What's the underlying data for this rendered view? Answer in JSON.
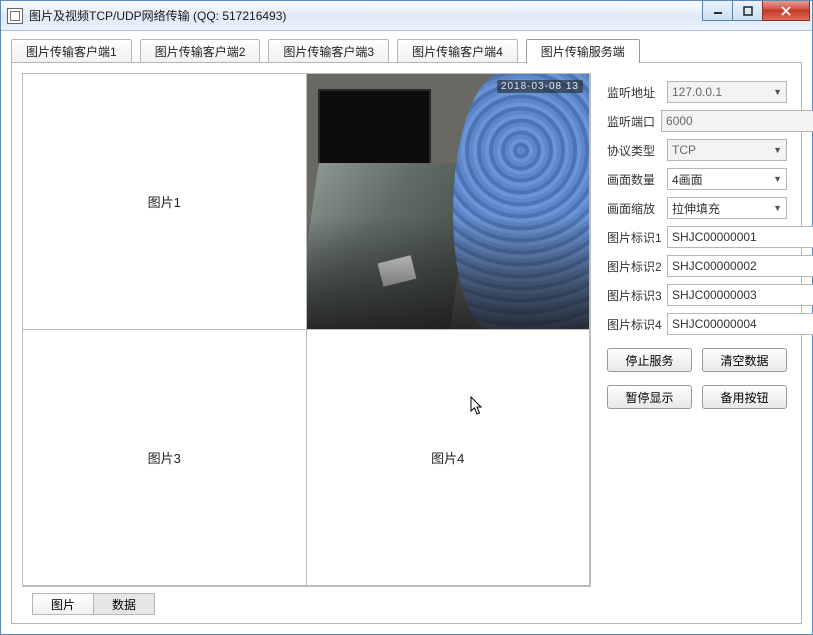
{
  "window_title": "图片及视频TCP/UDP网络传输 (QQ: 517216493)",
  "tabs": {
    "client1": "图片传输客户端1",
    "client2": "图片传输客户端2",
    "client3": "图片传输客户端3",
    "client4": "图片传输客户端4",
    "server": "图片传输服务端"
  },
  "panes": {
    "p1": "图片1",
    "p3": "图片3",
    "p4": "图片4",
    "video_overlay": "2018-03-08 13"
  },
  "subtabs": {
    "image": "图片",
    "data": "数据"
  },
  "form": {
    "listen_addr_label": "监听地址",
    "listen_addr_value": "127.0.0.1",
    "listen_port_label": "监听端口",
    "listen_port_value": "6000",
    "protocol_label": "协议类型",
    "protocol_value": "TCP",
    "count_label": "画面数量",
    "count_value": "4画面",
    "scale_label": "画面缩放",
    "scale_value": "拉伸填充",
    "id1_label": "图片标识1",
    "id1_value": "SHJC00000001",
    "id2_label": "图片标识2",
    "id2_value": "SHJC00000002",
    "id3_label": "图片标识3",
    "id3_value": "SHJC00000003",
    "id4_label": "图片标识4",
    "id4_value": "SHJC00000004"
  },
  "buttons": {
    "stop": "停止服务",
    "clear": "清空数据",
    "pause": "暂停显示",
    "spare": "备用按钮"
  }
}
